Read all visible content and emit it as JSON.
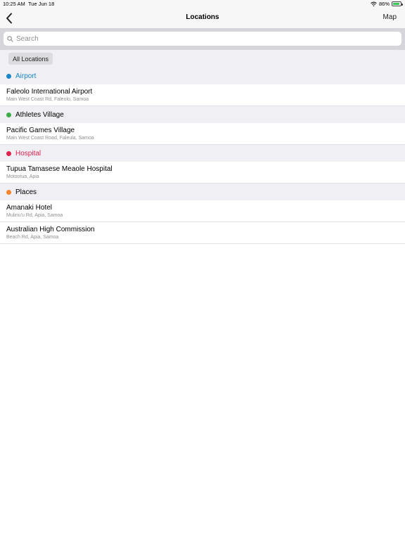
{
  "status_bar": {
    "time": "10:25 AM",
    "date": "Tue Jun 18",
    "battery_pct": "86%",
    "battery_level": 0.86
  },
  "nav": {
    "title": "Locations",
    "right_button": "Map"
  },
  "search": {
    "placeholder": "Search",
    "value": ""
  },
  "filter": {
    "selected": "All Locations"
  },
  "sections": [
    {
      "name": "Airport",
      "color": "#1a86c8",
      "title_color": "#1a86c8",
      "items": [
        {
          "title": "Faleolo International Airport",
          "subtitle": "Main West Coast Rd, Faleolo, Samoa"
        }
      ]
    },
    {
      "name": "Athletes Village",
      "color": "#3fae49",
      "title_color": "#000000",
      "items": [
        {
          "title": "Pacific Games Village",
          "subtitle": "Main West Coast Road, Faleula, Samoa"
        }
      ]
    },
    {
      "name": "Hospital",
      "color": "#e0234e",
      "title_color": "#e0234e",
      "items": [
        {
          "title": "Tupua Tamasese Meaole Hospital",
          "subtitle": "Motootua, Apia"
        }
      ]
    },
    {
      "name": "Places",
      "color": "#f5842b",
      "title_color": "#000000",
      "items": [
        {
          "title": "Amanaki Hotel",
          "subtitle": "Mulinu'u Rd, Apia, Samoa"
        },
        {
          "title": "Australian High Commission",
          "subtitle": "Beach Rd, Apia, Samoa"
        }
      ]
    }
  ],
  "icons": {
    "back": "chevron-left-icon",
    "search": "search-icon",
    "wifi": "wifi-icon",
    "battery": "battery-icon"
  }
}
